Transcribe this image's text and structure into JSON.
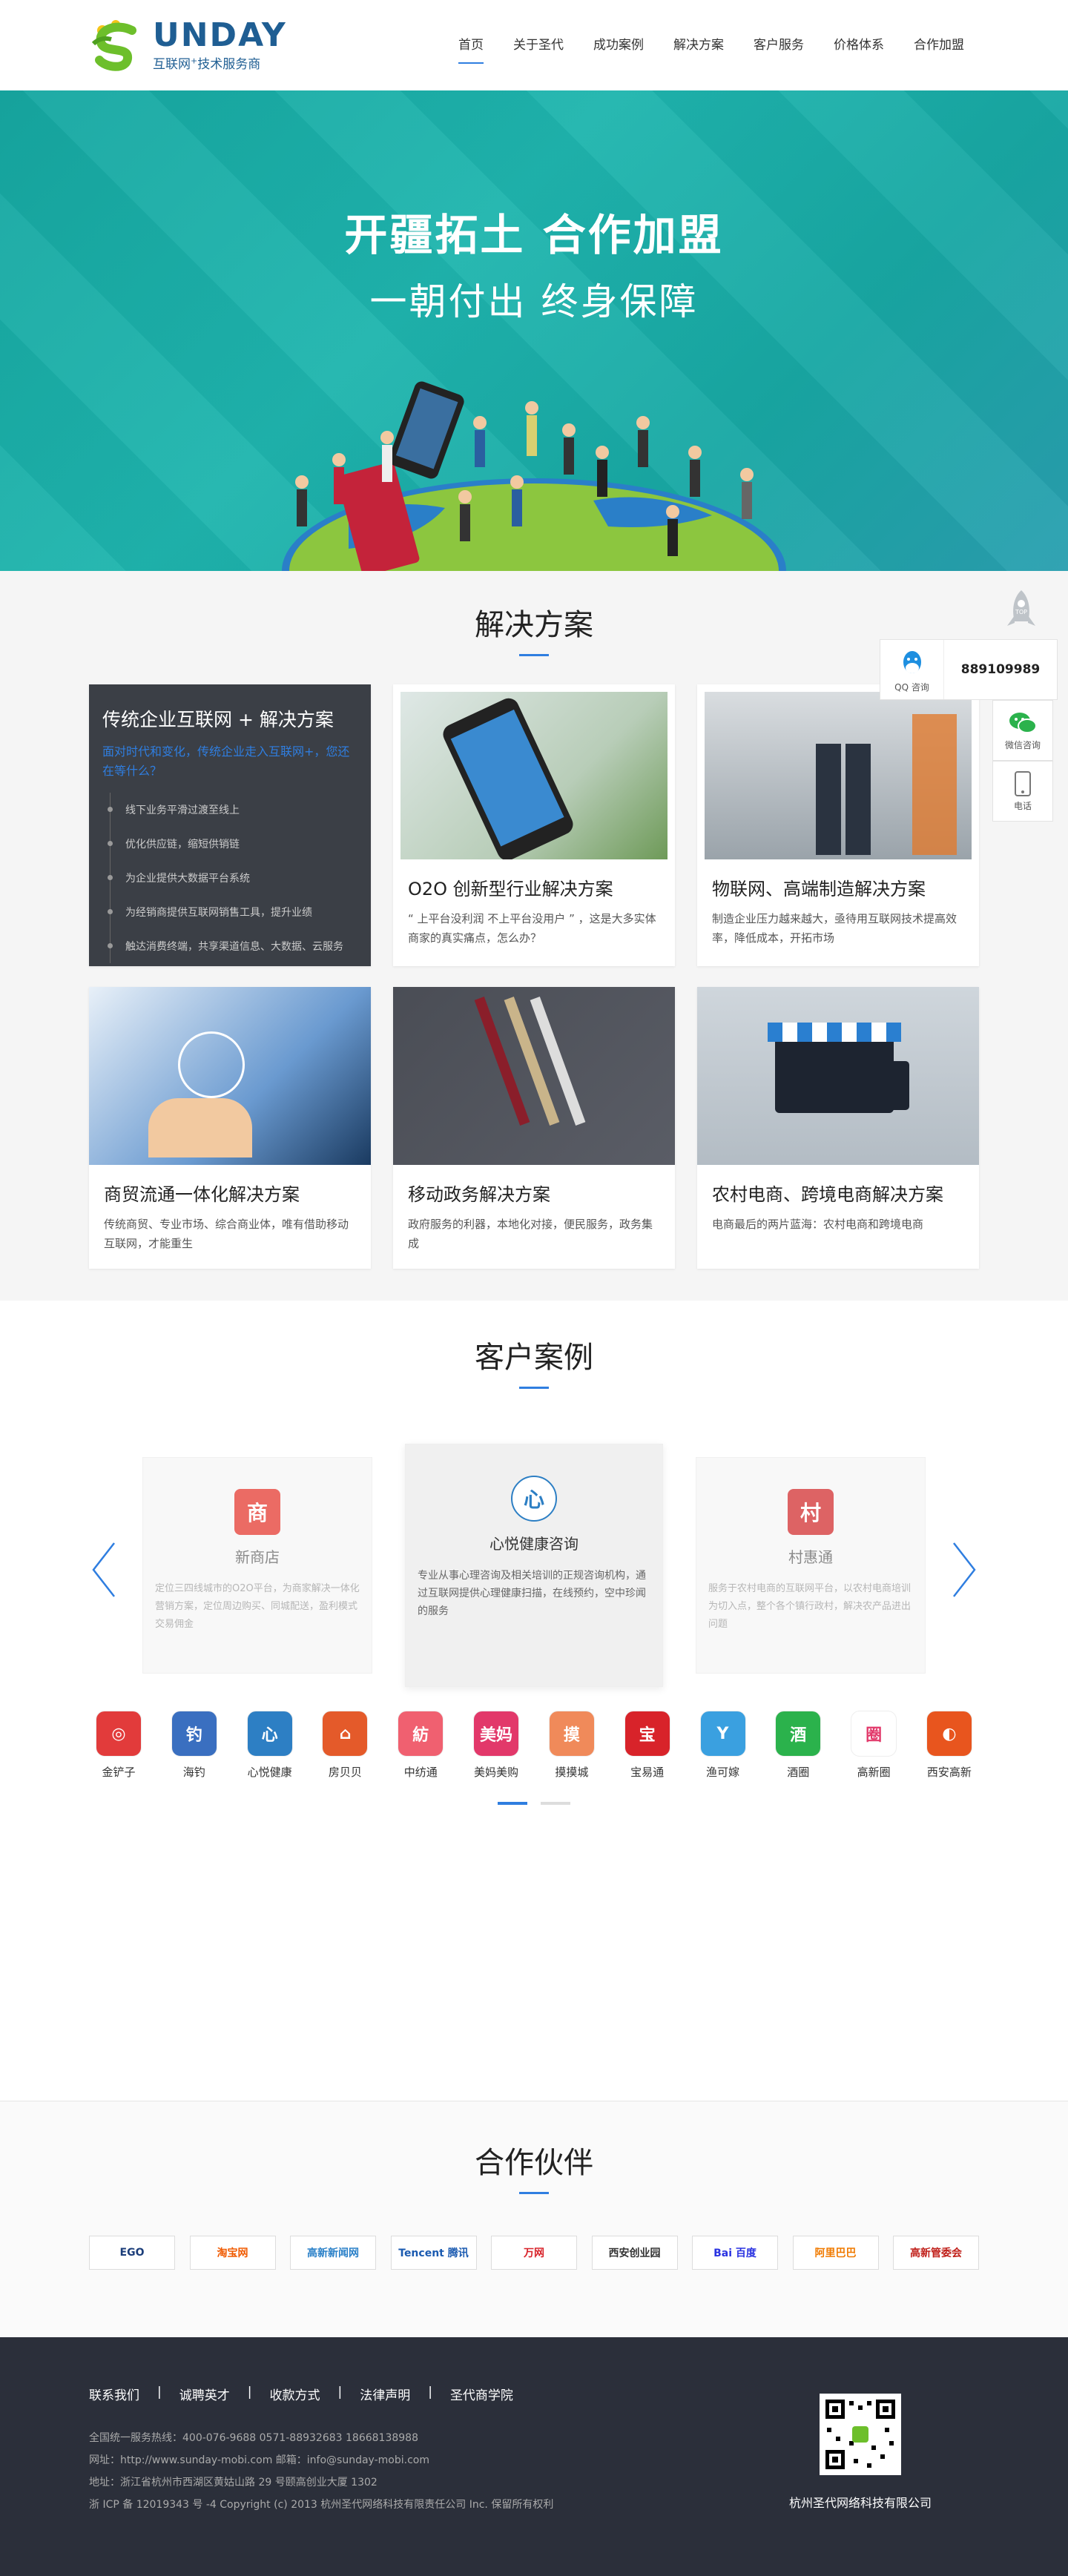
{
  "header": {
    "brand": "UNDAY",
    "slogan_pre": "互联网",
    "slogan_post": "技术服务商",
    "nav": [
      {
        "label": "首页",
        "active": true
      },
      {
        "label": "关于圣代"
      },
      {
        "label": "成功案例"
      },
      {
        "label": "解决方案"
      },
      {
        "label": "客户服务"
      },
      {
        "label": "价格体系"
      },
      {
        "label": "合作加盟"
      }
    ]
  },
  "banner": {
    "title": "开疆拓土  合作加盟",
    "subtitle": "一朝付出  终身保障"
  },
  "solutions": {
    "title": "解决方案",
    "featured": {
      "title": "传统企业互联网 + 解决方案",
      "subtitle": "面对时代和变化，传统企业走入互联网+，您还在等什么？",
      "items": [
        "线下业务平滑过渡至线上",
        "优化供应链，缩短供销链",
        "为企业提供大数据平台系统",
        "为经销商提供互联网销售工具，提升业绩",
        "触达消费终端，共享渠道信息、大数据、云服务"
      ]
    },
    "cards": [
      {
        "title": "O2O 创新型行业解决方案",
        "desc": "“ 上平台没利润 不上平台没用户 ” ，这是大多实体商家的真实痛点，怎么办？"
      },
      {
        "title": "物联网、高端制造解决方案",
        "desc": "制造企业压力越来越大，亟待用互联网技术提高效率，降低成本，开拓市场"
      },
      {
        "title": "商贸流通一体化解决方案",
        "desc": "传统商贸、专业市场、综合商业体，唯有借助移动互联网，才能重生"
      },
      {
        "title": "移动政务解决方案",
        "desc": "政府服务的利器，本地化对接，便民服务，政务集成"
      },
      {
        "title": "农村电商、跨境电商解决方案",
        "desc": "电商最后的两片蓝海：农村电商和跨境电商"
      }
    ]
  },
  "cases": {
    "title": "客户案例",
    "carousel": [
      {
        "name": "新商店",
        "icon_text": "商",
        "desc": "定位三四线城市的O2O平台，为商家解决一体化营销方案，定位周边购买、同城配送，盈利模式交易佣金"
      },
      {
        "name": "心悦健康咨询",
        "icon_text": "心",
        "desc": "专业从事心理咨询及相关培训的正规咨询机构，通过互联网提供心理健康扫描，在线预约，空中珍闻的服务"
      },
      {
        "name": "村惠通",
        "icon_text": "村",
        "desc": "服务于农村电商的互联网平台，以农村电商培训为切入点，整个各个镇行政村，解决农产品进出问题"
      }
    ],
    "logos": [
      {
        "name": "金铲子",
        "color": "#e23b3b",
        "mark": "◎"
      },
      {
        "name": "海钓",
        "color": "#3a6fc0",
        "mark": "钓"
      },
      {
        "name": "心悦健康",
        "color": "#2d7fc4",
        "mark": "心"
      },
      {
        "name": "房贝贝",
        "color": "#e45a2a",
        "mark": "⌂"
      },
      {
        "name": "中纺通",
        "color": "#f06070",
        "mark": "紡"
      },
      {
        "name": "美妈美购",
        "color": "#e2386a",
        "mark": "美妈"
      },
      {
        "name": "摸摸城",
        "color": "#f08a5a",
        "mark": "摸"
      },
      {
        "name": "宝易通",
        "color": "#d8232a",
        "mark": "宝"
      },
      {
        "name": "渔可嫁",
        "color": "#3aa0e0",
        "mark": "Y"
      },
      {
        "name": "酒圈",
        "color": "#2bb24c",
        "mark": "酒"
      },
      {
        "name": "高新圈",
        "color": "#ffffff",
        "mark": "圈"
      },
      {
        "name": "西安高新",
        "color": "#e8551e",
        "mark": "◐"
      }
    ],
    "arrow_left": "‹",
    "arrow_right": "›"
  },
  "partners": {
    "title": "合作伙伴",
    "list": [
      {
        "name": "EGO",
        "color": "#1c3e7a"
      },
      {
        "name": "淘宝网",
        "color": "#f05a00"
      },
      {
        "name": "高新新闻网",
        "color": "#2a80c8"
      },
      {
        "name": "Tencent 腾讯",
        "color": "#1a5ab0"
      },
      {
        "name": "万网",
        "color": "#d8232a"
      },
      {
        "name": "西安创业园",
        "color": "#333333"
      },
      {
        "name": "Bai 百度",
        "color": "#2932e1"
      },
      {
        "name": "阿里巴巴",
        "color": "#f07a00"
      },
      {
        "name": "高新管委会",
        "color": "#c0201a"
      }
    ]
  },
  "footer": {
    "links": [
      "联系我们",
      "诚聘英才",
      "收款方式",
      "法律声明",
      "圣代商学院"
    ],
    "separator": "|",
    "hotline": "全国统一服务热线：400-076-9688 0571-88932683 18668138988",
    "site": "网址：http://www.sunday-mobi.com  邮箱：info@sunday-mobi.com",
    "address": "地址：浙江省杭州市西湖区黄姑山路 29 号颐高创业大厦 1302",
    "icp": "浙 ICP 备 12019343 号 -4    Copyright (c) 2013 杭州圣代网络科技有限责任公司 Inc. 保留所有权利",
    "company": "杭州圣代网络科技有限公司"
  },
  "side": {
    "top_label": "TOP",
    "qq_label": "QQ 咨询",
    "qq_number": "889109989",
    "wechat_label": "微信咨询",
    "phone_label": "电话"
  }
}
